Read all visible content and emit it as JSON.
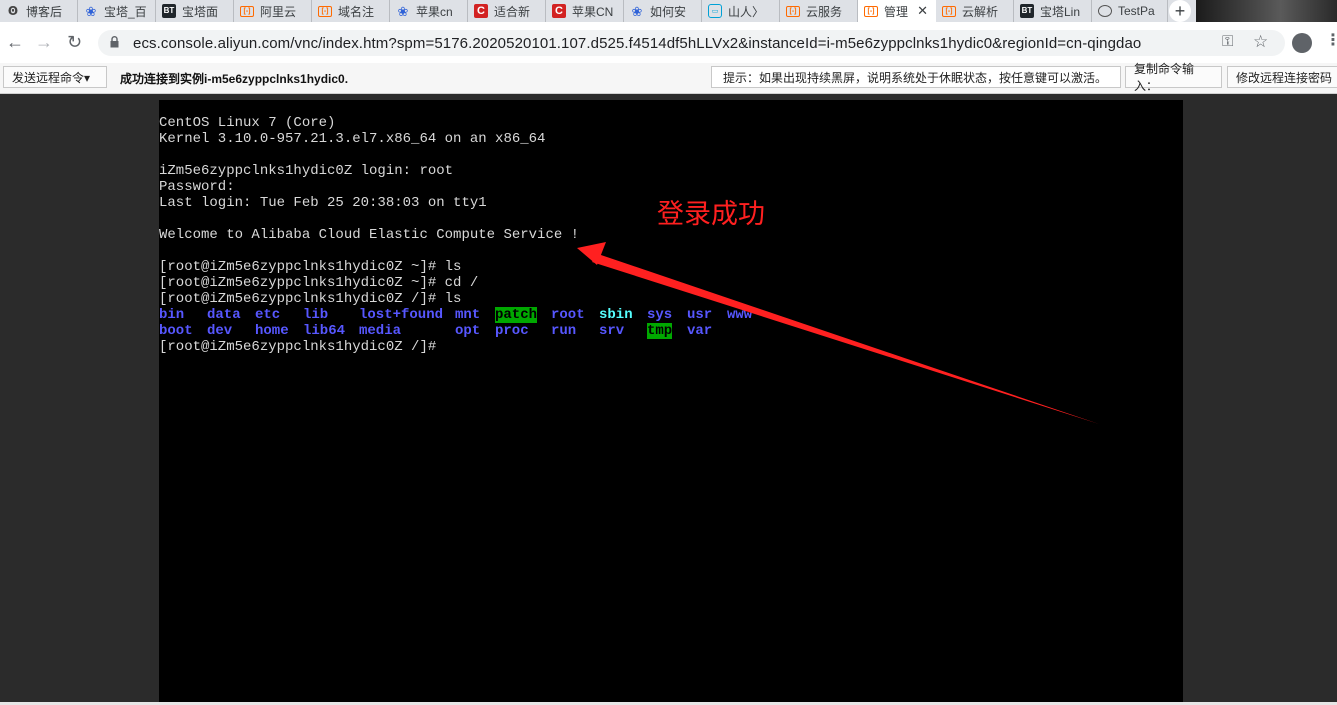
{
  "tabs": [
    {
      "label": "博客后",
      "icon": "blog-icon"
    },
    {
      "label": "宝塔_百",
      "icon": "baidu-paw-icon"
    },
    {
      "label": "宝塔面",
      "icon": "bt-icon"
    },
    {
      "label": "阿里云",
      "icon": "aliyun-icon"
    },
    {
      "label": "域名注",
      "icon": "aliyun-icon"
    },
    {
      "label": "苹果cn",
      "icon": "baidu-paw-icon"
    },
    {
      "label": "适合新",
      "icon": "csdn-icon"
    },
    {
      "label": "苹果CN",
      "icon": "csdn-icon"
    },
    {
      "label": "如何安",
      "icon": "baidu-paw-icon"
    },
    {
      "label": "山人〉",
      "icon": "bilibili-tv-icon"
    },
    {
      "label": "云服务",
      "icon": "aliyun-icon"
    },
    {
      "label": "管理",
      "icon": "aliyun-icon",
      "active": true,
      "close": "✕"
    },
    {
      "label": "云解析",
      "icon": "aliyun-icon"
    },
    {
      "label": "宝塔Lin",
      "icon": "bt-icon"
    },
    {
      "label": "TestPa",
      "icon": "globe-icon"
    }
  ],
  "tab_icon_text": {
    "bt": "BT",
    "aliyun": "[-]",
    "csdn": "C",
    "tv": "▭",
    "blog": "Ꙩ",
    "paw": "❀"
  },
  "newtab": "+",
  "nav": {
    "back": "←",
    "forward": "→",
    "reload": "↻",
    "url": "ecs.console.aliyun.com/vnc/index.htm?spm=5176.2020520101.107.d525.f4514df5hLLVx2&instanceId=i-m5e6zyppclnks1hydic0&regionId=cn-qingdao",
    "key": "⚿",
    "star": "☆",
    "menu": "⋮"
  },
  "vnc": {
    "send_remote_cmd": "发送远程命令▾",
    "status": "成功连接到实例i-m5e6zyppclnks1hydic0.",
    "hint": "提示：如果出现持续黑屏，说明系统处于休眠状态，按任意键可以激活。",
    "copy_cmd": "复制命令输入：",
    "change_pwd": "修改远程连接密码"
  },
  "terminal": {
    "lines": [
      "CentOS Linux 7 (Core)",
      "Kernel 3.10.0-957.21.3.el7.x86_64 on an x86_64",
      "",
      "iZm5e6zyppclnks1hydic0Z login: root",
      "Password:",
      "Last login: Tue Feb 25 20:38:03 on tty1",
      "",
      "Welcome to Alibaba Cloud Elastic Compute Service !",
      "",
      "[root@iZm5e6zyppclnks1hydic0Z ~]# ls",
      "[root@iZm5e6zyppclnks1hydic0Z ~]# cd /",
      "[root@iZm5e6zyppclnks1hydic0Z /]# ls"
    ],
    "ls_row1": [
      "bin",
      "data",
      "etc",
      "lib",
      "lost+found",
      "mnt",
      "patch",
      "root",
      "sbin",
      "sys",
      "usr",
      "www"
    ],
    "ls_row2": [
      "boot",
      "dev",
      "home",
      "lib64",
      "media",
      "opt",
      "proc",
      "run",
      "srv",
      "tmp",
      "var"
    ],
    "prompt": "[root@iZm5e6zyppclnks1hydic0Z /]#"
  },
  "annotation": {
    "text": "登录成功",
    "color": "#ff2020"
  },
  "colors": {
    "dir_blue": "#5757ff",
    "dir_cyan": "#55ffff",
    "highlight_green": "#00a800",
    "terminal_bg": "#000000"
  }
}
